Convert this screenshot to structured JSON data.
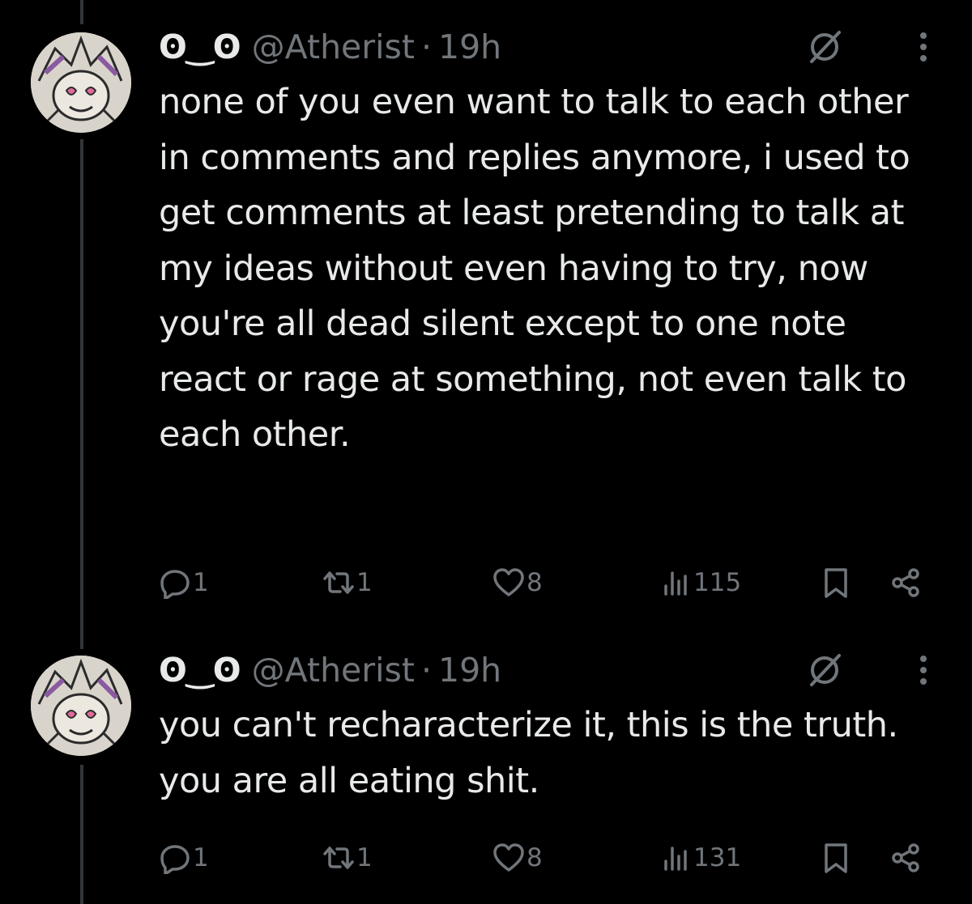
{
  "tweets": [
    {
      "display_name": "ʘ‿ʘ",
      "handle": "@Atherist",
      "separator": "·",
      "time": "19h",
      "text": "none of you even want to talk to each other in comments and replies anymore, i used to get comments at least pretending to talk at my ideas without even having to try, now you're all dead silent except to one note react or rage at something, not even talk to each other.",
      "replies": "1",
      "reposts": "1",
      "likes": "8",
      "views": "115"
    },
    {
      "display_name": "ʘ‿ʘ",
      "handle": "@Atherist",
      "separator": "·",
      "time": "19h",
      "text": "you can't recharacterize it, this is the truth. you are all eating shit.",
      "replies": "1",
      "reposts": "1",
      "likes": "8",
      "views": "131"
    }
  ],
  "icons": [
    "avatar",
    "grok-icon",
    "more-icon",
    "reply-icon",
    "repost-icon",
    "like-icon",
    "views-icon",
    "bookmark-icon",
    "share-icon"
  ],
  "colors": {
    "background": "#000000",
    "text": "#e7e9ea",
    "muted": "#71767b",
    "thread_line": "#333639"
  }
}
